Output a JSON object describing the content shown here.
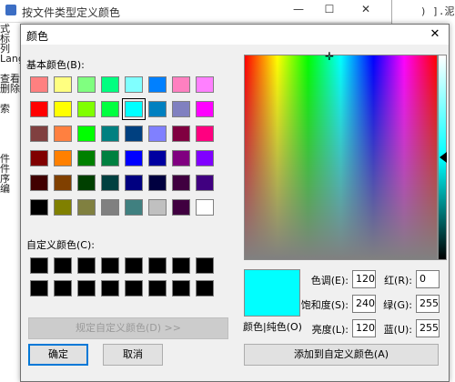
{
  "background_window": {
    "title": "按文件类型定义颜色",
    "minimize": "—",
    "maximize": "☐",
    "close": "✕",
    "left_fragments": [
      "式",
      "标",
      "列",
      "Lang",
      "",
      "查看",
      "删除",
      "",
      "索",
      "",
      "",
      "",
      "",
      "件",
      "件",
      "序",
      "编"
    ],
    "right_code": ") ].泥"
  },
  "dialog": {
    "title": "颜色",
    "close": "✕",
    "basic_colors_label": "基本颜色(B):",
    "basic_colors": [
      "#ff8080",
      "#ffff80",
      "#80ff80",
      "#00ff80",
      "#80ffff",
      "#0080ff",
      "#ff80c0",
      "#ff80ff",
      "#ff0000",
      "#ffff00",
      "#80ff00",
      "#00ff40",
      "#00ffff",
      "#0080c0",
      "#8080c0",
      "#ff00ff",
      "#804040",
      "#ff8040",
      "#00ff00",
      "#008080",
      "#004080",
      "#8080ff",
      "#800040",
      "#ff0080",
      "#800000",
      "#ff8000",
      "#008000",
      "#008040",
      "#0000ff",
      "#0000a0",
      "#800080",
      "#8000ff",
      "#400000",
      "#804000",
      "#004000",
      "#004040",
      "#000080",
      "#000040",
      "#400040",
      "#400080",
      "#000000",
      "#808000",
      "#808040",
      "#808080",
      "#408080",
      "#c0c0c0",
      "#400040",
      "#ffffff"
    ],
    "selected_index": 12,
    "custom_colors_label": "自定义颜色(C):",
    "custom_colors": [
      "#000000",
      "#000000",
      "#000000",
      "#000000",
      "#000000",
      "#000000",
      "#000000",
      "#000000",
      "#000000",
      "#000000",
      "#000000",
      "#000000",
      "#000000",
      "#000000",
      "#000000",
      "#000000"
    ],
    "define_custom_button": "规定自定义颜色(D) >>",
    "ok_button": "确定",
    "cancel_button": "取消",
    "preview_color": "#00ffff",
    "preview_label": "颜色|纯色(O)",
    "hue_label": "色调(E):",
    "hue_value": "120",
    "sat_label": "饱和度(S):",
    "sat_value": "240",
    "lum_label": "亮度(L):",
    "lum_value": "120",
    "red_label": "红(R):",
    "red_value": "0",
    "green_label": "绿(G):",
    "green_value": "255",
    "blue_label": "蓝(U):",
    "blue_value": "255",
    "add_custom_button": "添加到自定义颜色(A)"
  }
}
